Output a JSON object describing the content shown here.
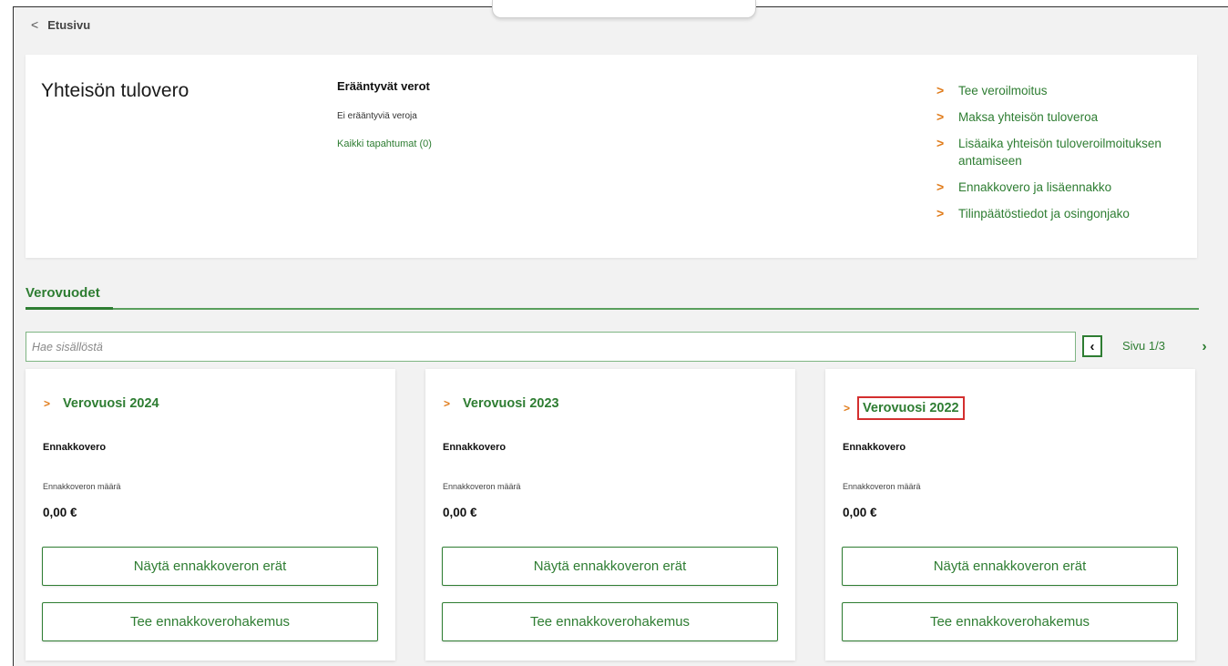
{
  "nav": {
    "back_label": "Etusivu",
    "back_icon": "chevron-left-icon"
  },
  "summary": {
    "title": "Yhteisön tulovero",
    "due": {
      "heading": "Erääntyvät verot",
      "none_text": "Ei erääntyviä veroja",
      "all_events_link": "Kaikki tapahtumat (0)"
    },
    "links": [
      {
        "label": "Tee veroilmoitus"
      },
      {
        "label": "Maksa yhteisön tuloveroa"
      },
      {
        "label": "Lisäaika yhteisön tuloveroilmoituksen antamiseen"
      },
      {
        "label": "Ennakkovero ja lisäennakko"
      },
      {
        "label": "Tilinpäätöstiedot ja osingonjako"
      }
    ]
  },
  "tax_years": {
    "section_title": "Verovuodet",
    "search": {
      "placeholder": "Hae sisällöstä",
      "value": ""
    },
    "pager": {
      "label": "Sivu 1/3",
      "current_page": 1,
      "total_pages": 3
    },
    "cards": [
      {
        "title": "Verovuosi 2024",
        "highlighted": false,
        "section_label": "Ennakkovero",
        "amount_label": "Ennakkoveron määrä",
        "amount": "0,00 €",
        "installments_button": "Näytä ennakkoveron erät",
        "apply_button": "Tee ennakkoverohakemus"
      },
      {
        "title": "Verovuosi 2023",
        "highlighted": false,
        "section_label": "Ennakkovero",
        "amount_label": "Ennakkoveron määrä",
        "amount": "0,00 €",
        "installments_button": "Näytä ennakkoveron erät",
        "apply_button": "Tee ennakkoverohakemus"
      },
      {
        "title": "Verovuosi 2022",
        "highlighted": true,
        "section_label": "Ennakkovero",
        "amount_label": "Ennakkoveron määrä",
        "amount": "0,00 €",
        "installments_button": "Näytä ennakkoveron erät",
        "apply_button": "Tee ennakkoverohakemus"
      }
    ]
  },
  "colors": {
    "brand_green": "#2e7d32",
    "accent_orange": "#e07b1a",
    "highlight_red": "#d32f2f"
  }
}
